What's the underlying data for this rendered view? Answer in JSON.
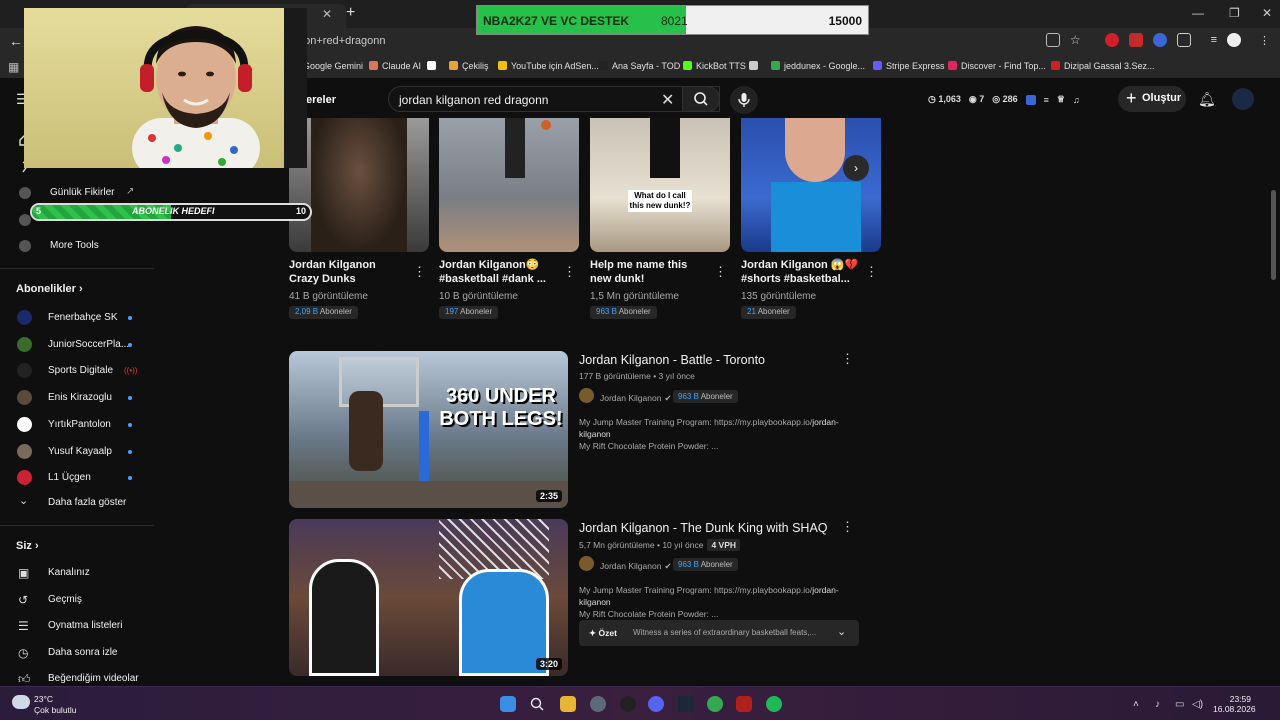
{
  "browser": {
    "url": "non+red+dragonn",
    "bookmarks": [
      {
        "label": "Google Gemini",
        "color": "#7b8cff"
      },
      {
        "label": "Claude AI",
        "color": "#d97757"
      },
      {
        "label": "",
        "color": "#ffffff"
      },
      {
        "label": "Çekiliş",
        "color": "#e8a23a"
      },
      {
        "label": "YouTube için AdSen...",
        "color": "#f4c20d"
      },
      {
        "label": "Ana Sayfa - TOD",
        "color": "#222222"
      },
      {
        "label": "KickBot TTS",
        "color": "#53fc18"
      },
      {
        "label": "",
        "color": "#cccccc"
      },
      {
        "label": "jeddunex - Google...",
        "color": "#34a853"
      },
      {
        "label": "Stripe Express",
        "color": "#635bff"
      },
      {
        "label": "Discover - Find Top...",
        "color": "#e0245e"
      },
      {
        "label": "Dizipal Gassal 3.Sez...",
        "color": "#cc2222"
      }
    ]
  },
  "stream_goal": {
    "title": "NBA2K27 VE VC DESTEK",
    "current": "8021",
    "max": "15000",
    "fill": 0.535
  },
  "sub_goal": {
    "start": "5",
    "label": "ABONELIK HEDEFI",
    "end": "10",
    "fill": 0.5
  },
  "youtube": {
    "filter_fragment": "ereler",
    "search_query": "jordan kilganon red dragonn",
    "stats": {
      "watch": "1,063",
      "views": "7",
      "eye": "286"
    },
    "create_label": "Oluştur"
  },
  "sidebar": {
    "top_items": [
      "Günlük Fikirler",
      "More Tools"
    ],
    "subs_heading": "Abonelikler",
    "subs": [
      {
        "name": "Fenerbahçe SK",
        "color": "#1b2a6b"
      },
      {
        "name": "JuniorSoccerPla...",
        "color": "#3a6b2a"
      },
      {
        "name": "Sports Digitale",
        "color": "#222222"
      },
      {
        "name": "Enis Kirazoglu",
        "color": "#5a4a3a"
      },
      {
        "name": "YırtıkPantolon",
        "color": "#ffffff"
      },
      {
        "name": "Yusuf Kayaalp",
        "color": "#7a6a5a"
      },
      {
        "name": "L1 Üçgen",
        "color": "#cc2233"
      }
    ],
    "show_more": "Daha fazla göster",
    "you_heading": "Siz",
    "you_items": [
      "Kanalınız",
      "Geçmiş",
      "Oynatma listeleri",
      "Daha sonra izle",
      "Beğendiğim videolar"
    ]
  },
  "shorts": [
    {
      "title": "Jordan Kilganon Crazy Dunks",
      "views": "41 B görüntüleme",
      "subs": "2,09 B",
      "subs_suffix": "Aboneler"
    },
    {
      "title": "Jordan Kilganon😳 #basketball #dank ...",
      "views": "10 B görüntüleme",
      "subs": "197",
      "subs_suffix": "Aboneler"
    },
    {
      "title": "Help me name this new dunk!",
      "views": "1,5 Mn görüntüleme",
      "subs": "963 B",
      "subs_suffix": "Aboneler",
      "overlay": "What do I call this new dunk!?"
    },
    {
      "title": "Jordan Kilganon 😱💔 #shorts #basketbal...",
      "views": "135 görüntüleme",
      "subs": "21",
      "subs_suffix": "Aboneler"
    }
  ],
  "videos": [
    {
      "title": "Jordan Kilganon - Battle - Toronto",
      "views": "177 B görüntüleme",
      "age": "3 yıl önce",
      "vph": "",
      "channel": "Jordan Kilganon",
      "subs": "963 B",
      "subs_suffix": "Aboneler",
      "desc1": "My Jump Master Training Program: https://my.playbookapp.io/",
      "desc1_bold": "jordan-kilganon",
      "desc2": "My Rift Chocolate Protein Powder: ...",
      "duration": "2:35",
      "thumb_text": "360 UNDER BOTH LEGS!"
    },
    {
      "title": "Jordan Kilganon - The Dunk King with SHAQ",
      "views": "5,7 Mn görüntüleme",
      "age": "10 yıl önce",
      "vph": "4 VPH",
      "channel": "Jordan Kilganon",
      "subs": "963 B",
      "subs_suffix": "Aboneler",
      "desc1": "My Jump Master Training Program: https://my.playbookapp.io/",
      "desc1_bold": "jordan-kilganon",
      "desc2": "My Rift Chocolate Protein Powder: ...",
      "duration": "3:20",
      "ozet_label": "Özet",
      "ozet_text": "Witness a series of extraordinary basketball feats,..."
    }
  ],
  "taskbar": {
    "temp": "23°C",
    "weather": "Çok bulutlu",
    "time": "23:59",
    "date": "16.08.2026"
  }
}
